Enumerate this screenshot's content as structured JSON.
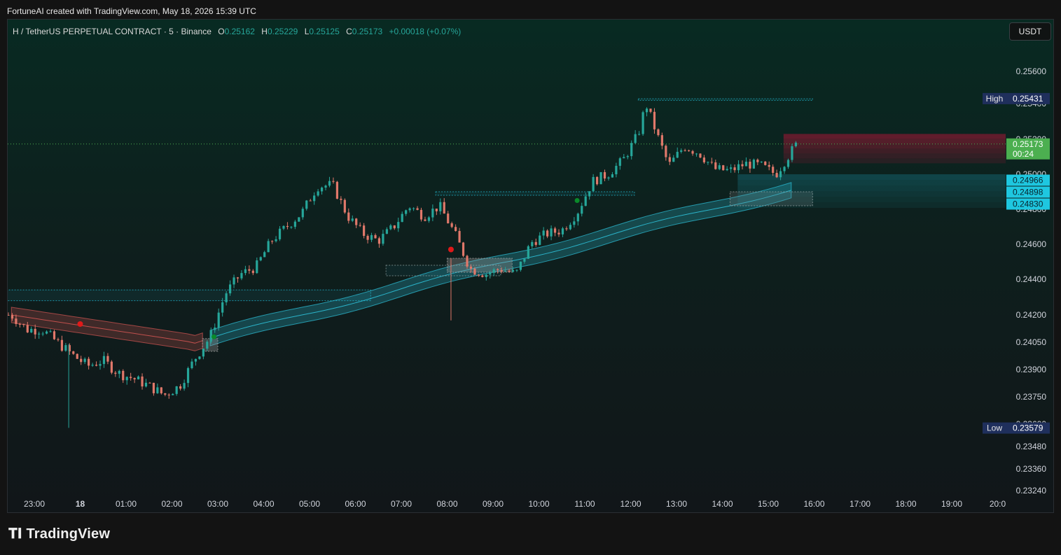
{
  "caption": "FortuneAI created with TradingView.com, May 18, 2026 15:39 UTC",
  "legend": {
    "symbol": "H / TetherUS PERPETUAL CONTRACT · 5 · Binance",
    "o_label": "O",
    "o": "0.25162",
    "h_label": "H",
    "h": "0.25229",
    "l_label": "L",
    "l": "0.25125",
    "c_label": "C",
    "c": "0.25173",
    "change": "+0.00018 (+0.07%)"
  },
  "currency_button": "USDT",
  "brand": "TradingView",
  "colors": {
    "up": "#26a69a",
    "down": "#e0786a",
    "band_bull": "#2bb3c9",
    "band_bear": "#c0504d",
    "supply": "#c8143c",
    "demand": "#22c1dc",
    "high_low_tag": "#1f2f5c",
    "price_tag": "#4caf50"
  },
  "chart_data": {
    "type": "candlestick",
    "x_ticks": [
      "23:00",
      "18",
      "01:00",
      "02:00",
      "03:00",
      "04:00",
      "05:00",
      "06:00",
      "07:00",
      "08:00",
      "09:00",
      "10:00",
      "11:00",
      "12:00",
      "13:00",
      "14:00",
      "15:00",
      "16:00",
      "17:00",
      "18:00",
      "19:00",
      "20:0"
    ],
    "y_ticks": [
      "0.25600",
      "0.25400",
      "0.25200",
      "0.25000",
      "0.24800",
      "0.24600",
      "0.24400",
      "0.24200",
      "0.24050",
      "0.23900",
      "0.23750",
      "0.23600",
      "0.23480",
      "0.23360",
      "0.23240"
    ],
    "price_tags": [
      {
        "label": "High",
        "value": "0.25431"
      },
      {
        "label": "",
        "value": "0.25173",
        "sub": "00:24"
      },
      {
        "label": "",
        "value": "0.24966"
      },
      {
        "label": "",
        "value": "0.24898"
      },
      {
        "label": "",
        "value": "0.24830"
      },
      {
        "label": "Low",
        "value": "0.23579"
      }
    ],
    "anchors": [
      [
        "22:30",
        0.242
      ],
      [
        "22:50",
        0.2412
      ],
      [
        "23:10",
        0.2412
      ],
      [
        "23:30",
        0.2405
      ],
      [
        "23:50",
        0.2398
      ],
      [
        "00:10",
        0.2392
      ],
      [
        "00:30",
        0.2395
      ],
      [
        "00:50",
        0.2388
      ],
      [
        "01:10",
        0.2385
      ],
      [
        "01:30",
        0.2381
      ],
      [
        "01:50",
        0.2376
      ],
      [
        "02:10",
        0.2381
      ],
      [
        "02:30",
        0.2396
      ],
      [
        "02:50",
        0.2408
      ],
      [
        "03:10",
        0.2432
      ],
      [
        "03:30",
        0.2443
      ],
      [
        "03:50",
        0.2447
      ],
      [
        "04:10",
        0.2462
      ],
      [
        "04:30",
        0.247
      ],
      [
        "04:50",
        0.2478
      ],
      [
        "05:10",
        0.2493
      ],
      [
        "05:30",
        0.2494
      ],
      [
        "05:50",
        0.2476
      ],
      [
        "06:10",
        0.2466
      ],
      [
        "06:30",
        0.2462
      ],
      [
        "06:50",
        0.247
      ],
      [
        "07:10",
        0.2482
      ],
      [
        "07:30",
        0.2476
      ],
      [
        "07:50",
        0.2482
      ],
      [
        "08:10",
        0.2466
      ],
      [
        "08:30",
        0.2446
      ],
      [
        "08:50",
        0.2443
      ],
      [
        "09:10",
        0.2446
      ],
      [
        "09:30",
        0.2443
      ],
      [
        "09:50",
        0.2461
      ],
      [
        "10:10",
        0.2466
      ],
      [
        "10:30",
        0.2468
      ],
      [
        "10:50",
        0.2478
      ],
      [
        "11:10",
        0.2496
      ],
      [
        "11:30",
        0.25
      ],
      [
        "11:50",
        0.2508
      ],
      [
        "12:10",
        0.2523
      ],
      [
        "12:20",
        0.254
      ],
      [
        "12:35",
        0.2522
      ],
      [
        "12:50",
        0.2505
      ],
      [
        "13:10",
        0.2516
      ],
      [
        "13:30",
        0.2512
      ],
      [
        "13:50",
        0.2503
      ],
      [
        "14:10",
        0.2502
      ],
      [
        "14:30",
        0.2506
      ],
      [
        "14:50",
        0.2505
      ],
      [
        "15:10",
        0.25
      ],
      [
        "15:30",
        0.2513
      ],
      [
        "15:37",
        0.2517
      ]
    ]
  }
}
